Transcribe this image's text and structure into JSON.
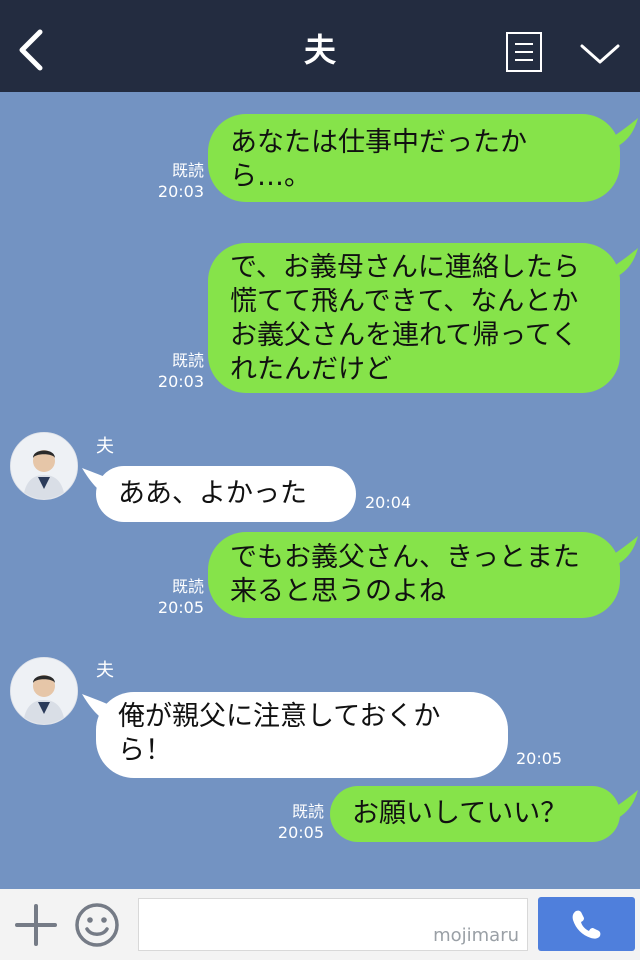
{
  "header": {
    "title": "夫"
  },
  "messages": [
    {
      "side": "sent",
      "text": "あなたは仕事中だったから…。",
      "read": "既読",
      "time": "20:03"
    },
    {
      "side": "sent",
      "text": "で、お義母さんに連絡したら慌てて飛んできて、なんとかお義父さんを連れて帰ってくれたんだけど",
      "read": "既読",
      "time": "20:03"
    },
    {
      "side": "recv",
      "sender": "夫",
      "text": "ああ、よかった",
      "time": "20:04"
    },
    {
      "side": "sent",
      "text": "でもお義父さん、きっとまた来ると思うのよね",
      "read": "既読",
      "time": "20:05"
    },
    {
      "side": "recv",
      "sender": "夫",
      "text": "俺が親父に注意しておくから！",
      "time": "20:05"
    },
    {
      "side": "sent",
      "text": "お願いしていい？",
      "read": "既読",
      "time": "20:05"
    }
  ],
  "footer": {
    "input_value": "",
    "watermark": "mojimaru"
  },
  "colors": {
    "background": "#7393c2",
    "header": "#232c40",
    "sent_bubble": "#86e34a",
    "recv_bubble": "#ffffff",
    "call_button": "#4f7fdc"
  },
  "icons": [
    "back-arrow-icon",
    "notes-icon",
    "chevron-down-icon",
    "plus-icon",
    "smile-icon",
    "phone-icon"
  ]
}
